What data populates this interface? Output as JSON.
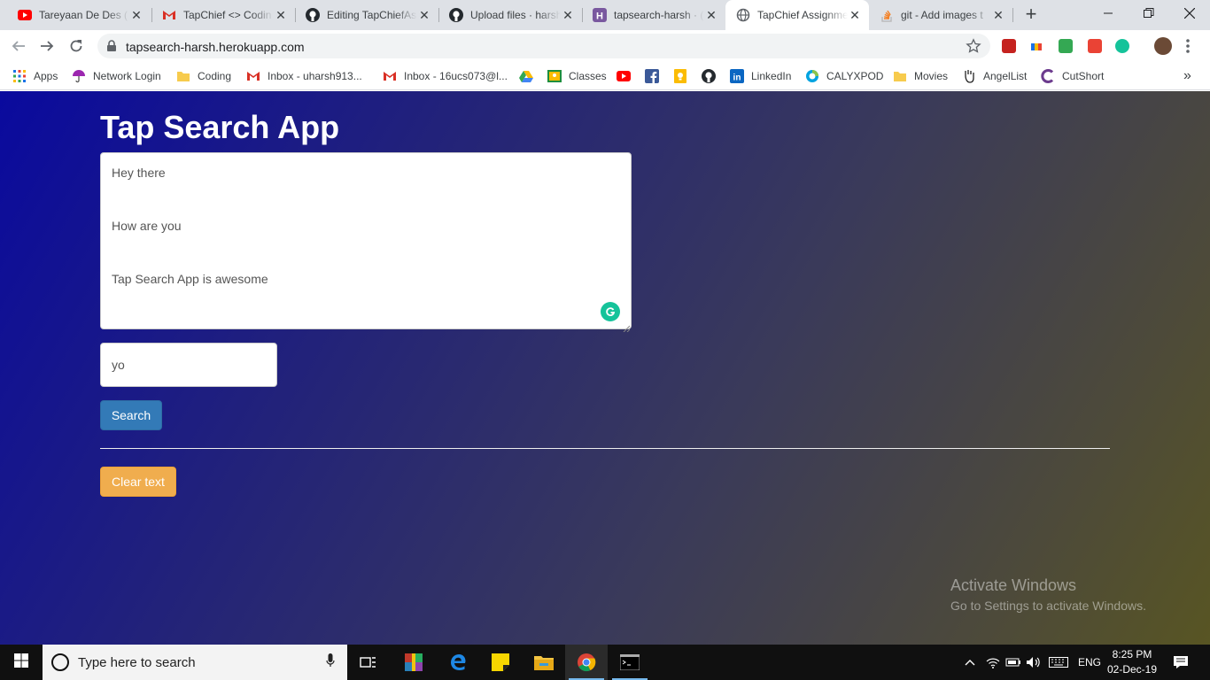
{
  "browser": {
    "tabs": [
      {
        "title": "Tareyaan De Des (",
        "icon": "youtube-icon"
      },
      {
        "title": "TapChief <> Codin",
        "icon": "gmail-icon"
      },
      {
        "title": "Editing TapChiefAs",
        "icon": "github-icon"
      },
      {
        "title": "Upload files · harsh",
        "icon": "github-icon"
      },
      {
        "title": "tapsearch-harsh · (",
        "icon": "heroku-icon"
      },
      {
        "title": "TapChief Assignme",
        "icon": "globe-icon",
        "active": true
      },
      {
        "title": "git - Add images t",
        "icon": "stackoverflow-icon"
      }
    ],
    "url": "tapsearch-harsh.herokuapp.com",
    "bookmarks": [
      {
        "label": "Apps",
        "icon": "apps-grid-icon"
      },
      {
        "label": "Network Login",
        "icon": "umbrella-icon"
      },
      {
        "label": "Coding",
        "icon": "folder-icon"
      },
      {
        "label": "Inbox - uharsh913...",
        "icon": "gmail-icon"
      },
      {
        "label": "Inbox - 16ucs073@l...",
        "icon": "gmail-icon"
      },
      {
        "label": "",
        "icon": "google-drive-icon"
      },
      {
        "label": "Classes",
        "icon": "classroom-icon"
      },
      {
        "label": "",
        "icon": "youtube-icon"
      },
      {
        "label": "",
        "icon": "facebook-icon"
      },
      {
        "label": "",
        "icon": "keep-icon"
      },
      {
        "label": "",
        "icon": "github-icon"
      },
      {
        "label": "LinkedIn",
        "icon": "linkedin-icon"
      },
      {
        "label": "CALYXPOD",
        "icon": "calyxpod-icon"
      },
      {
        "label": "Movies",
        "icon": "folder-icon"
      },
      {
        "label": "AngelList",
        "icon": "angellist-icon"
      },
      {
        "label": "CutShort",
        "icon": "cutshort-icon"
      }
    ],
    "more": "»"
  },
  "app": {
    "title": "Tap Search App",
    "textarea_lines": [
      "Hey there",
      "How are you",
      "Tap Search App is awesome"
    ],
    "search_value": "yo",
    "search_button": "Search",
    "clear_button": "Clear text"
  },
  "watermark": {
    "line1": "Activate Windows",
    "line2": "Go to Settings to activate Windows."
  },
  "taskbar": {
    "search_placeholder": "Type here to search",
    "language": "ENG",
    "time": "8:25 PM",
    "date": "02-Dec-19"
  },
  "colors": {
    "primary_button": "#337ab7",
    "warning_button": "#f0ad4e",
    "grammarly": "#15c39a"
  }
}
